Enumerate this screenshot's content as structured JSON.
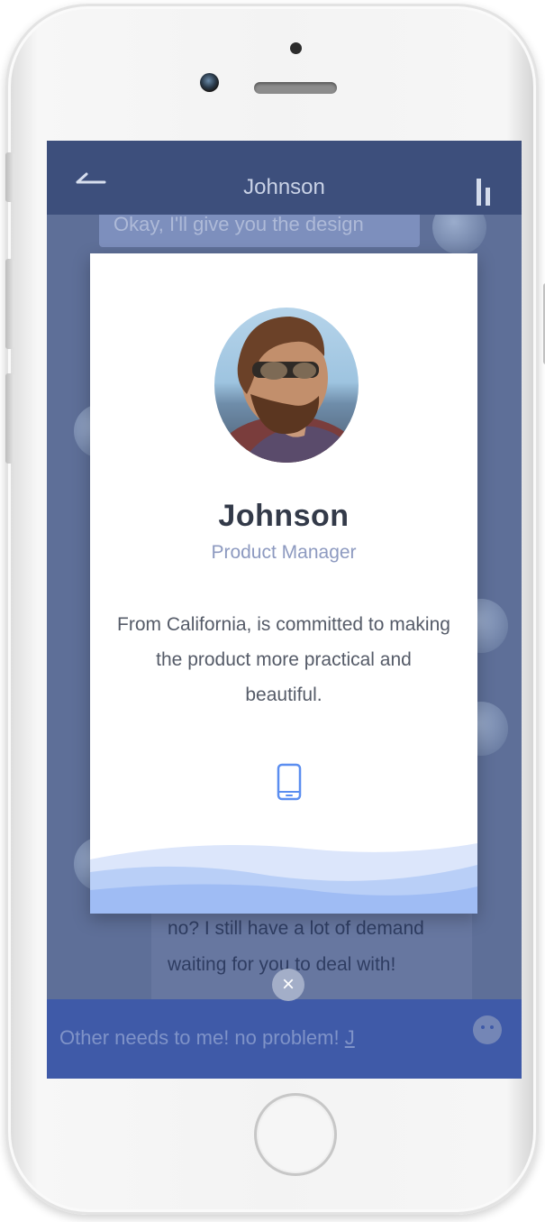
{
  "nav": {
    "title": "Johnson",
    "back_icon": "back-arrow-icon",
    "menu_icon": "signal-bars-icon"
  },
  "chat": {
    "top_message": "Okay, I'll give you the design",
    "bottom_message": "no? I still have a lot of demand waiting for you to deal with!",
    "input_value": "Other needs to me! no problem!",
    "input_cursor_char": "J",
    "emoji_icon": "smiley-icon"
  },
  "profile": {
    "name": "Johnson",
    "role": "Product Manager",
    "bio": "From California, is committed to making the product more practical and beautiful.",
    "contact_icon": "mobile-phone-icon",
    "accent_color": "#5b8ef0"
  },
  "overlay": {
    "close_label": "×",
    "close_icon": "close-icon"
  }
}
